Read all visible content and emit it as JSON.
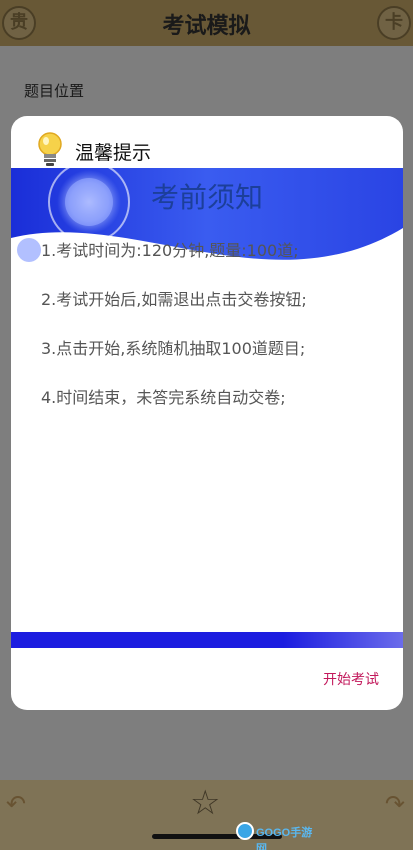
{
  "header": {
    "title": "考试模拟",
    "left_icon": "贵",
    "right_icon": "卡"
  },
  "main": {
    "position_label": "题目位置"
  },
  "dialog": {
    "title": "温馨提示",
    "notice_heading": "考前须知",
    "rules": [
      "1.考试时间为:120分钟,题量:100道;",
      "2.考试开始后,如需退出点击交卷按钮;",
      "3.点击开始,系统随机抽取100道题目;",
      "4.时间结束，未答完系统自动交卷;"
    ],
    "start_button": "开始考试"
  },
  "footer": {
    "prev_icon": "arrow-left-icon",
    "star_icon": "star-icon",
    "next_icon": "arrow-right-icon"
  },
  "watermark": {
    "text": "GOGO手游网"
  },
  "colors": {
    "accent": "#c2185b",
    "banner_blue": "#1c1de0",
    "topbar": "#c7a968"
  }
}
